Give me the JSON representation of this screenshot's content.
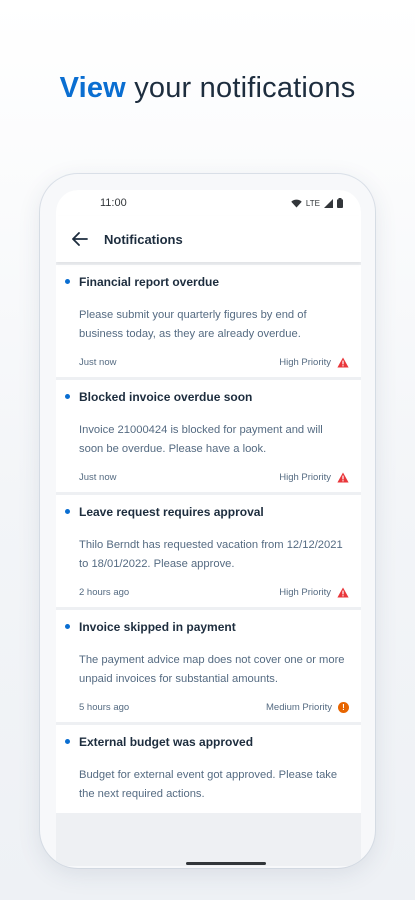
{
  "headline": {
    "accent": "View",
    "rest": " your notifications"
  },
  "status_bar": {
    "time": "11:00",
    "network": "LTE"
  },
  "app_bar": {
    "title": "Notifications"
  },
  "colors": {
    "accent": "#0a6ed1",
    "high_priority": "#e9363a",
    "medium_priority": "#e76500"
  },
  "notifications": [
    {
      "title": "Financial report overdue",
      "body": "Please submit your quarterly figures by end of business today, as they are already overdue.",
      "time": "Just now",
      "priority": "High Priority",
      "priority_icon": "warning-triangle-icon"
    },
    {
      "title": "Blocked invoice overdue soon",
      "body": "Invoice 21000424 is blocked for payment and will soon be overdue. Please have a look.",
      "time": "Just now",
      "priority": "High Priority",
      "priority_icon": "warning-triangle-icon"
    },
    {
      "title": "Leave request requires approval",
      "body": "Thilo Berndt has requested vacation from 12/12/2021 to 18/01/2022. Please approve.",
      "time": "2 hours ago",
      "priority": "High Priority",
      "priority_icon": "warning-triangle-icon"
    },
    {
      "title": "Invoice skipped in payment",
      "body": "The payment advice map does not cover one or more unpaid invoices for substantial amounts.",
      "time": "5 hours ago",
      "priority": "Medium Priority",
      "priority_icon": "exclamation-circle-icon",
      "priority_icon_glyph": "!"
    },
    {
      "title": "External budget was approved",
      "body": "Budget for external event got approved. Please take the next required actions."
    }
  ]
}
